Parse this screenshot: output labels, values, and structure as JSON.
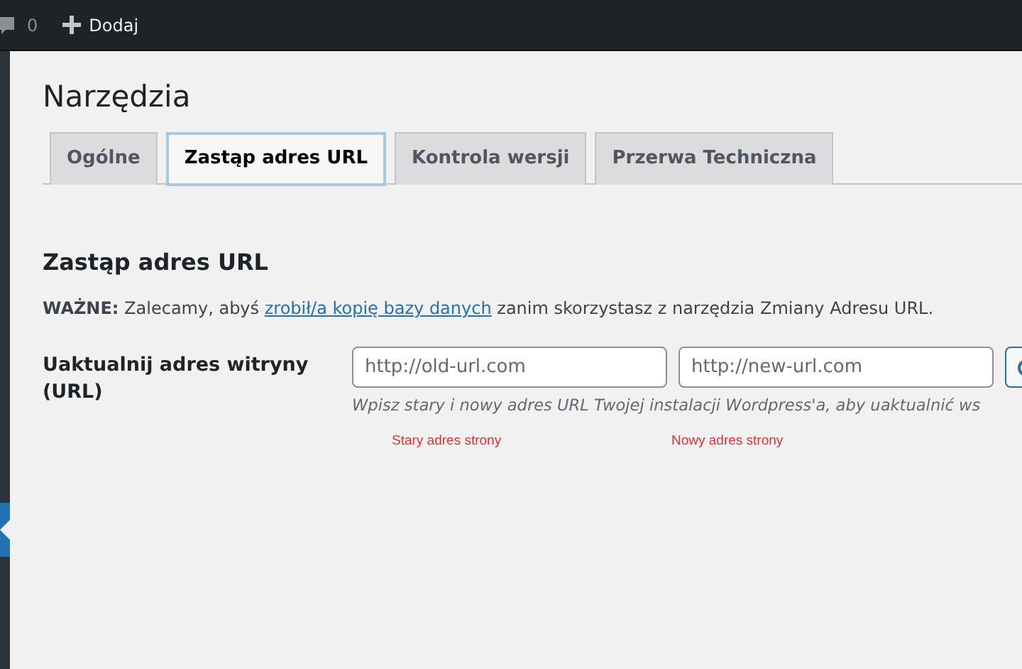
{
  "admin_bar": {
    "comments_count": "0",
    "add_new": "Dodaj"
  },
  "page_title": "Narzędzia",
  "tabs": [
    {
      "label": "Ogólne",
      "selected": false
    },
    {
      "label": "Zastąp adres URL",
      "selected": true
    },
    {
      "label": "Kontrola wersji",
      "selected": false
    },
    {
      "label": "Przerwa Techniczna",
      "selected": false
    }
  ],
  "section": {
    "heading": "Zastąp adres URL",
    "notice": "**WAŻNE:** Zalecamy, abyś ",
    "notice_link": "zrobił/a kopię bazy danych",
    "notice_end": " zanim skorzystasz z narzędzia Zmiany Adresu URL.",
    "field_label": "Uaktualnij adres witryny (URL)",
    "old_url": {
      "placeholder": "http://old-url.com"
    },
    "new_url": {
      "placeholder": "http://new-url.com"
    },
    "description": "Wpisz stary i nowy adres URL Twojej instalacji Wordpress'a, aby uaktualnić ws",
    "annotations": [
      "Stary adres strony",
      "Nowy adres strony"
    ]
  }
}
